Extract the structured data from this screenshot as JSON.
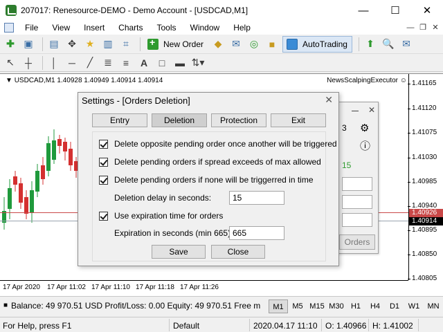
{
  "window": {
    "title": "207017: Renesource-DEMO - Demo Account - [USDCAD,M1]"
  },
  "menu": [
    "File",
    "View",
    "Insert",
    "Charts",
    "Tools",
    "Window",
    "Help"
  ],
  "toolbar": {
    "new_order": "New Order",
    "autotrading": "AutoTrading"
  },
  "chart": {
    "symbol_info": "USDCAD,M1  1.40928 1.40949 1.40914 1.40914",
    "ea_name": "NewsScalpingExecutor",
    "price_ticks": [
      "1.41165",
      "1.41120",
      "1.41075",
      "1.41030",
      "1.40985",
      "1.40940",
      "1.40895",
      "1.40850",
      "1.40805"
    ],
    "bid_tag": "1.40926",
    "last_tag": "1.40914",
    "time_ticks": [
      "17 Apr 2020",
      "17 Apr 11:02",
      "17 Apr 11:10",
      "17 Apr 11:18",
      "17 Apr 11:26"
    ]
  },
  "ea_panel": {
    "value1": "3",
    "value2": "15",
    "orders_btn": "Orders"
  },
  "dialog": {
    "title": "Settings - [Orders Deletion]",
    "tabs": [
      "Entry",
      "Deletion",
      "Protection",
      "Exit"
    ],
    "active_tab": "Deletion",
    "options": {
      "opt1": "Delete opposite pending order once another will be triggered",
      "opt2": "Delete pending orders if spread exceeds of max allowed",
      "opt3": "Delete pending orders if none will be triggerred in time",
      "opt4": "Use expiration time for orders"
    },
    "delay_label": "Deletion delay in seconds:",
    "delay_value": "15",
    "expiration_label": "Expiration in seconds (min 665):",
    "expiration_value": "665",
    "save_btn": "Save",
    "close_btn": "Close"
  },
  "account": {
    "summary": "Balance: 49 970.51 USD  Profit/Loss: 0.00  Equity: 49 970.51  Free m"
  },
  "timeframes": [
    "M1",
    "M5",
    "M15",
    "M30",
    "H1",
    "H4",
    "D1",
    "W1",
    "MN"
  ],
  "active_timeframe": "M1",
  "status": {
    "help": "For Help, press F1",
    "profile": "Default",
    "datetime": "2020.04.17 11:10",
    "open": "O: 1.40966",
    "high": "H: 1.41002"
  },
  "colors": {
    "bull": "#1f9a3c",
    "bear": "#d43030",
    "bid_line": "#c94848",
    "ask_line": "#9aa4b0"
  }
}
